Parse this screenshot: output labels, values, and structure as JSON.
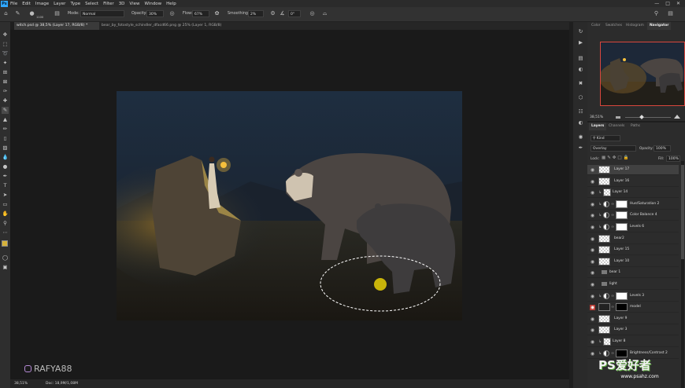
{
  "menu": {
    "items": [
      "File",
      "Edit",
      "Image",
      "Layer",
      "Type",
      "Select",
      "Filter",
      "3D",
      "View",
      "Window",
      "Help"
    ],
    "logo": "Ps"
  },
  "options": {
    "brush_size": "1100",
    "mode_label": "Mode:",
    "mode_value": "Normal",
    "opacity_label": "Opacity:",
    "opacity_value": "30%",
    "flow_label": "Flow:",
    "flow_value": "67%",
    "smoothing_label": "Smoothing:",
    "smoothing_value": "2%",
    "angle_value": "0°"
  },
  "tabs": [
    {
      "label": "witch.psd @ 38,5% (Layer 17, RGB/8) *",
      "active": true
    },
    {
      "label": "bear_by_fotostyle_schindler_dfacd66.png @ 25% (Layer 1, RGB/8)",
      "active": false
    }
  ],
  "status": {
    "zoom": "38,51%",
    "doc": "Doc: 18,9M/1,08M"
  },
  "watermark": "RAFYA88",
  "navigator": {
    "tabs": [
      "Color",
      "Swatches",
      "Histogram",
      "Navigator"
    ],
    "active_tab": "Navigator",
    "zoom": "38,51%"
  },
  "layers_panel": {
    "tabs": [
      "Layers",
      "Channels",
      "Paths"
    ],
    "active_tab": "Layers",
    "filter_label": "Kind",
    "blend_mode": "Overlay",
    "opacity_label": "Opacity:",
    "opacity_value": "100%",
    "lock_label": "Lock:",
    "fill_label": "Fill:",
    "fill_value": "100%",
    "layers": [
      {
        "name": "Layer 17",
        "kind": "pixel",
        "selected": true,
        "clipped": false
      },
      {
        "name": "Layer 16",
        "kind": "pixel",
        "selected": false,
        "clipped": false
      },
      {
        "name": "Layer 14",
        "kind": "pixel-small",
        "selected": false,
        "clipped": true
      },
      {
        "name": "Hue/Saturation 2",
        "kind": "adjustment",
        "selected": false,
        "clipped": true
      },
      {
        "name": "Color Balance 4",
        "kind": "adjustment",
        "selected": false,
        "clipped": true
      },
      {
        "name": "Levels 6",
        "kind": "adjustment",
        "selected": false,
        "clipped": true
      },
      {
        "name": "bear2",
        "kind": "pixel",
        "selected": false,
        "clipped": false
      },
      {
        "name": "Layer 15",
        "kind": "pixel",
        "selected": false,
        "clipped": false
      },
      {
        "name": "Layer 10",
        "kind": "pixel",
        "selected": false,
        "clipped": false
      },
      {
        "name": "bear 1",
        "kind": "group",
        "selected": false,
        "clipped": false
      },
      {
        "name": "light",
        "kind": "group",
        "selected": false,
        "clipped": false
      },
      {
        "name": "Levels 3",
        "kind": "adjustment",
        "selected": false,
        "clipped": true
      },
      {
        "name": "model",
        "kind": "masked",
        "selected": false,
        "clipped": false,
        "eye_red": true
      },
      {
        "name": "Layer 9",
        "kind": "pixel",
        "selected": false,
        "clipped": false
      },
      {
        "name": "Layer 3",
        "kind": "pixel",
        "selected": false,
        "clipped": false
      },
      {
        "name": "Layer 8",
        "kind": "pixel-small",
        "selected": false,
        "clipped": true
      },
      {
        "name": "Brightness/Contrast 2",
        "kind": "adjustment-black",
        "selected": false,
        "clipped": true
      }
    ]
  },
  "site_logo": {
    "text": "PS爱好者",
    "url": "www.psahz.com"
  },
  "colors": {
    "accent": "#31a8ff",
    "selection": "#ffffff",
    "brush_cursor": "#c9b40a",
    "eye_red": "#b8372f"
  }
}
